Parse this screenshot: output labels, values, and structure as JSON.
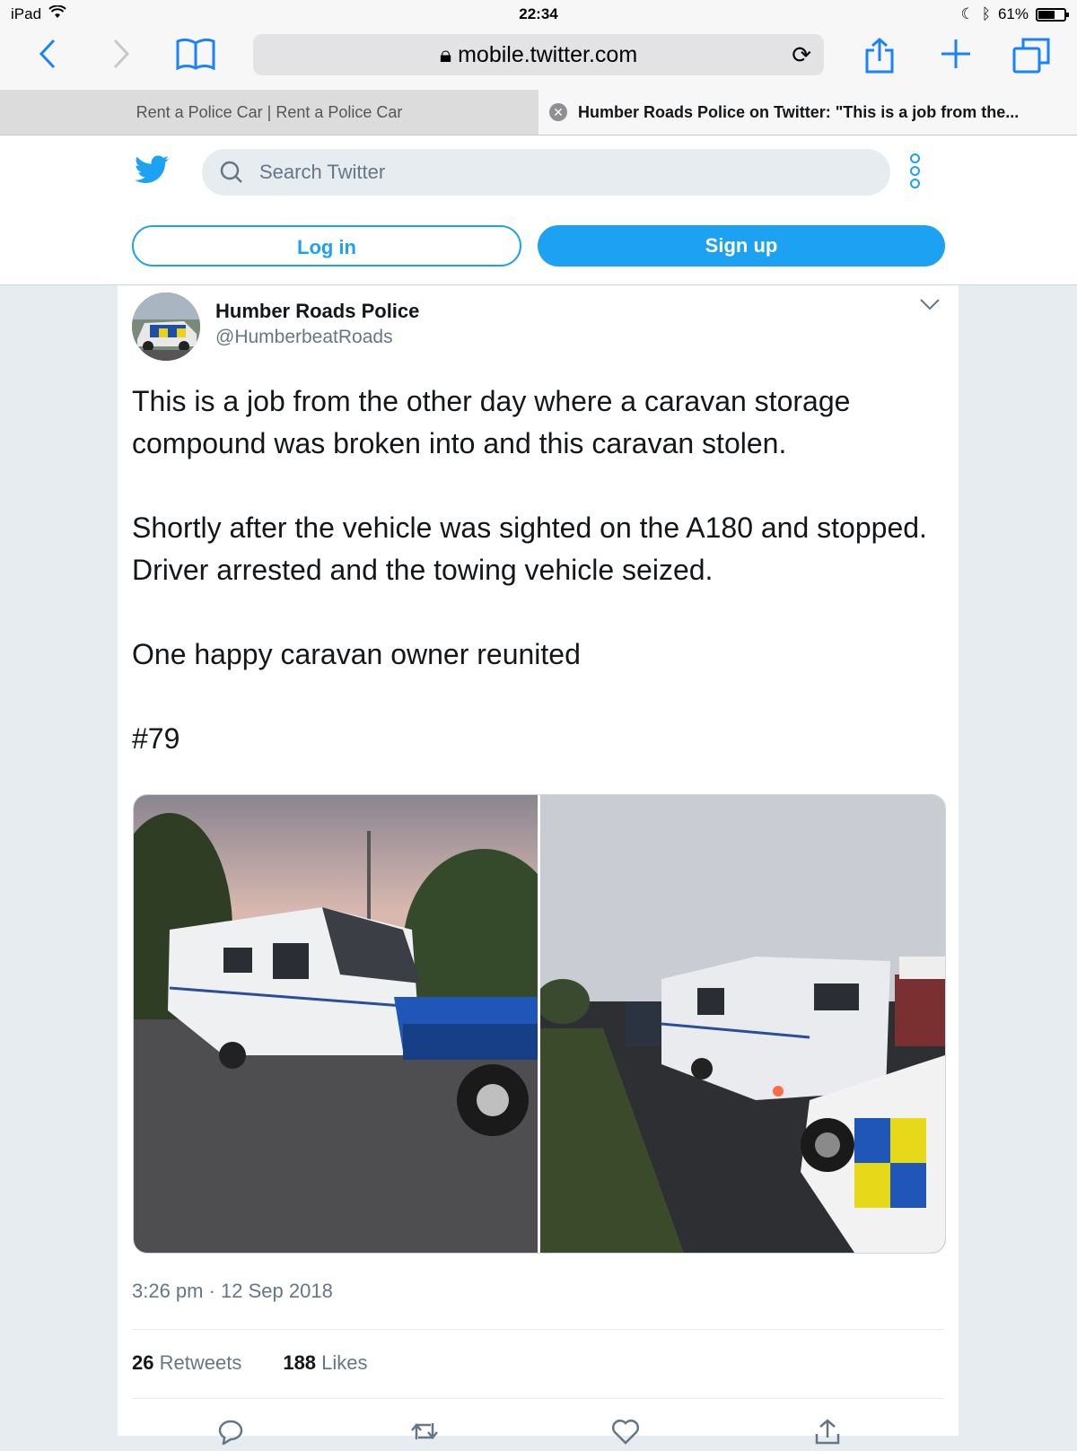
{
  "status_bar": {
    "device": "iPad",
    "time": "22:34",
    "battery": "61%"
  },
  "browser": {
    "url": "mobile.twitter.com",
    "tabs": [
      {
        "label": "Rent a Police Car | Rent a Police Car"
      },
      {
        "label": "Humber Roads Police on Twitter: \"This is a job from the..."
      }
    ]
  },
  "twitter_header": {
    "search_placeholder": "Search Twitter",
    "login_label": "Log in",
    "signup_label": "Sign up"
  },
  "tweet": {
    "author_name": "Humber Roads Police",
    "author_handle": "@HumberbeatRoads",
    "paragraphs": [
      "This is a job from the other day where a caravan storage compound was broken into and this caravan stolen.",
      "Shortly after the vehicle was sighted on the A180 and stopped. Driver arrested and the towing vehicle seized.",
      "One happy caravan owner reunited",
      "#79"
    ],
    "timestamp": "3:26 pm · 12 Sep 2018",
    "retweets_count": "26",
    "retweets_label": "Retweets",
    "likes_count": "188",
    "likes_label": "Likes"
  },
  "icons": {
    "bird": "twitter-bird-icon",
    "search": "search-icon",
    "more": "more-vertical-icon",
    "chevron": "chevron-down-icon",
    "reply": "reply-icon",
    "retweet": "retweet-icon",
    "like": "heart-icon",
    "share": "share-icon"
  },
  "colors": {
    "brand": "#1da1f2",
    "safari_accent": "#1a82fb"
  }
}
